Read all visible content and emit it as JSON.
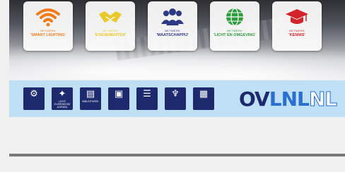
{
  "networks": [
    {
      "prefix": "NETWERK",
      "name": "'SMART LIGHTING'",
      "color": "#f07b1a",
      "icon": "wifi-icon"
    },
    {
      "prefix": "NETWERK",
      "name": "'EVENEMENTEN'",
      "color": "#e8c82a",
      "icon": "handshake-icon"
    },
    {
      "prefix": "NETWERK",
      "name": "'MAATSCHAPPIJ'",
      "color": "#2c3a86",
      "icon": "people-icon"
    },
    {
      "prefix": "NETWERK",
      "name": "'LICHT EN OMGEVING'",
      "color": "#2f9a3e",
      "icon": "globe-icon"
    },
    {
      "prefix": "NETWERK",
      "name": "'KENNIS'",
      "color": "#d2232a",
      "icon": "graduation-cap-icon"
    }
  ],
  "toolbar": [
    {
      "glyph": "⚙",
      "label": "",
      "icon": "gear-icon"
    },
    {
      "glyph": "✦",
      "label": "LICHT OVERHEIDSE AGENDA",
      "icon": "city-lights-icon"
    },
    {
      "glyph": "▤",
      "label": "BIBLIOTHEEK",
      "icon": "library-icon"
    },
    {
      "glyph": "▣",
      "label": "",
      "icon": "monitor-icon"
    },
    {
      "glyph": "☰",
      "label": "",
      "icon": "book-icon"
    },
    {
      "glyph": "♆",
      "label": "",
      "icon": "award-icon"
    },
    {
      "glyph": "▦",
      "label": "",
      "icon": "tablet-icon"
    }
  ],
  "logo": {
    "part1": "OV",
    "part2": "LNL",
    "part3": "NL"
  }
}
